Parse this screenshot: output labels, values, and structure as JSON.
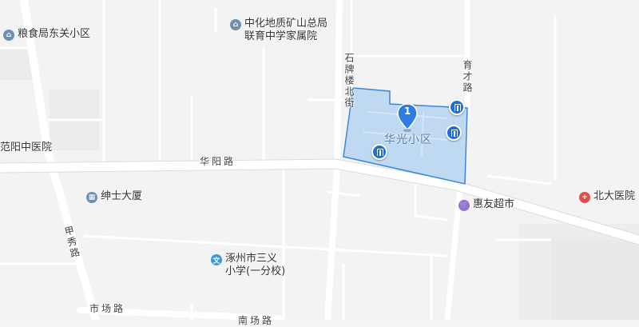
{
  "map": {
    "colors": {
      "background": "#f4f4f4",
      "road": "#ffffff",
      "highlight_fill": "#b9d6f2",
      "highlight_stroke": "#3d86d9",
      "entrance": "#1f6fd1"
    },
    "marker": {
      "number": "1"
    },
    "highlighted_area": {
      "name": "华光小区"
    },
    "pois": [
      {
        "name": "粮食局东关小区",
        "icon": "residential-icon"
      },
      {
        "name_line1": "中化地质矿山总局",
        "name_line2": "联育中学家属院",
        "icon": "residential-icon"
      },
      {
        "name": "范阳中医院",
        "icon": "none"
      },
      {
        "name": "绅士大厦",
        "icon": "building-icon"
      },
      {
        "name": "惠友超市",
        "icon": "shopping-icon"
      },
      {
        "name": "北大医院",
        "icon": "hospital-icon"
      },
      {
        "name_line1": "涿州市三义",
        "name_line2": "小学(一分校)",
        "icon": "school-icon"
      }
    ],
    "roads": {
      "huayang": "华阳路",
      "shipailou": "石牌楼北街",
      "yucai": "育才路",
      "jiaxiu": "甲秀路",
      "shichang": "市场路",
      "bottom_partial": "南场路"
    }
  }
}
